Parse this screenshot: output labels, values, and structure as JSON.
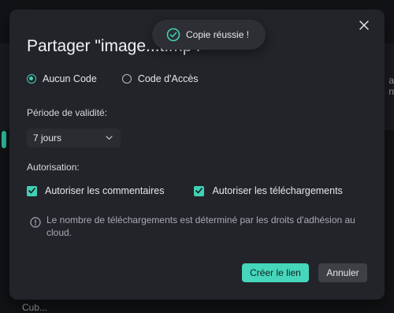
{
  "modal": {
    "title": "Partager \"image...t.mp4\"",
    "close_icon": "close-icon"
  },
  "toast": {
    "text": "Copie réussie !",
    "icon": "check-circle-icon",
    "color": "#3fd1b5"
  },
  "access": {
    "options": [
      {
        "label": "Aucun Code",
        "selected": true
      },
      {
        "label": "Code d'Accès",
        "selected": false
      }
    ]
  },
  "validity": {
    "label": "Période de validité:",
    "value": "7 jours"
  },
  "authorization": {
    "label": "Autorisation:",
    "options": [
      {
        "label": "Autoriser les commentaires",
        "checked": true
      },
      {
        "label": "Autoriser les téléchargements",
        "checked": true
      }
    ]
  },
  "info": {
    "text": "Le nombre de téléchargements est déterminé par les droits d'adhésion au cloud."
  },
  "buttons": {
    "create": "Créer le lien",
    "cancel": "Annuler"
  },
  "background": {
    "right_text_1": "a",
    "right_text_2": "n",
    "bottom_text": "Cub..."
  },
  "colors": {
    "accent": "#45d6bb",
    "dialog_bg": "#23242a"
  }
}
